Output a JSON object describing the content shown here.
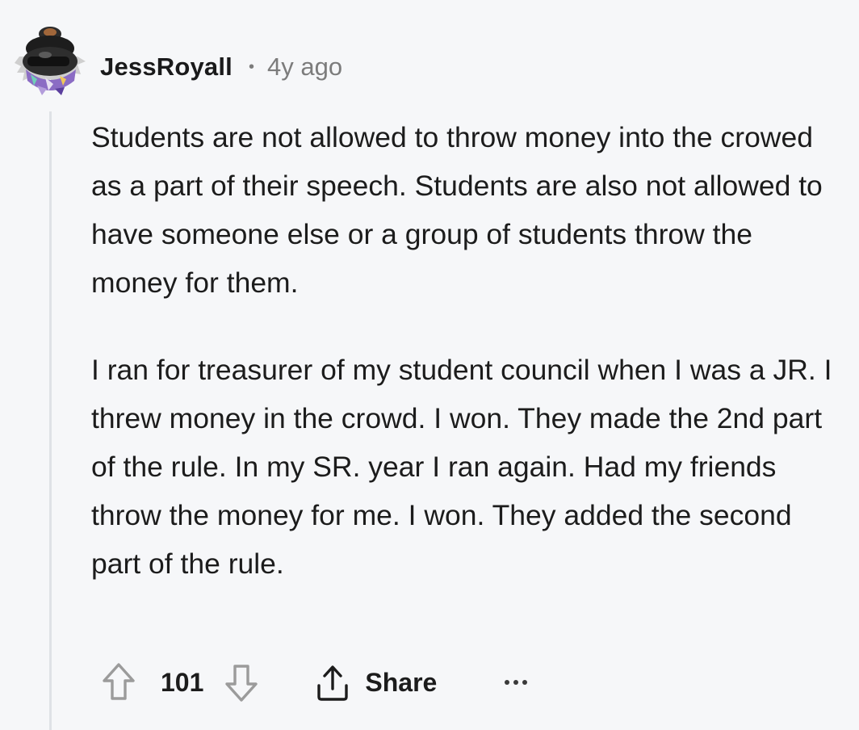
{
  "comment": {
    "username": "JessRoyall",
    "separator": "•",
    "time": "4y ago",
    "paragraphs": [
      "Students are not allowed to throw money into the crowed as a part of their speech. Students are also not allowed to have someone else or a group of students throw the money for them.",
      "I ran for treasurer of my student council when I was a JR. I threw money in the crowd. I won. They made the 2nd part of the rule. In my SR. year I ran again. Had my friends throw the money for me. I won. They added the second part of the rule."
    ],
    "score": "101",
    "share_label": "Share",
    "icons": {
      "avatar": "snoo-avatar",
      "upvote": "upvote-arrow-icon",
      "downvote": "downvote-arrow-icon",
      "share": "share-upload-icon",
      "more": "more-options-icon"
    }
  },
  "colors": {
    "background": "#f6f7f9",
    "text": "#1c1c1c",
    "meta": "#7c7c7c",
    "thread_line": "#dfe2e6"
  }
}
